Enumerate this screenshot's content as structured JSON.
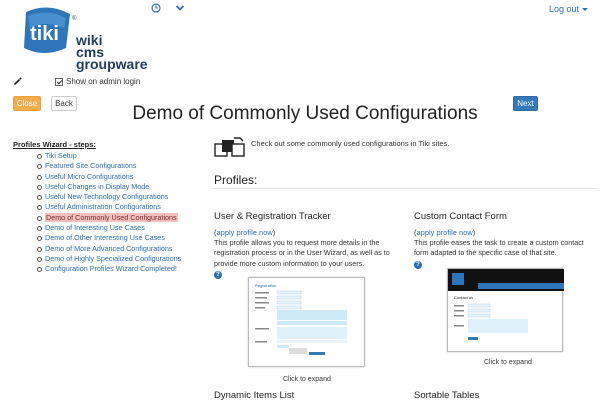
{
  "header": {
    "logout_label": "Log out",
    "icons": [
      "clock-icon",
      "chevron-down-icon"
    ]
  },
  "logo": {
    "brand": "tiki",
    "line1": "wiki",
    "line2": "cms",
    "line3": "groupware",
    "mark": "®"
  },
  "admin_login": {
    "label": "Show on admin login",
    "checked": true
  },
  "buttons": {
    "close": "Close",
    "back": "Back",
    "next": "Next"
  },
  "page_title": "Demo of Commonly Used Configurations",
  "sidebar": {
    "title": "Profiles Wizard - steps:",
    "steps": [
      "Tiki Setup",
      "Featured Site Configurations",
      "Useful Micro Configurations",
      "Useful Changes in Display Mode",
      "Useful New Technology Configurations",
      "Useful Administration Configurations",
      "Demo of Commonly Used Configurations",
      "Demo of Interesting Use Cases",
      "Demo of Other Interesting Use Cases",
      "Demo of More Advanced Configurations",
      "Demo of Highly Specialized Configurations",
      "Configuration Profiles Wizard Completed!"
    ],
    "active_index": 6
  },
  "intro_text": "Check out some commonly used configurations in Tiki sites.",
  "profiles_heading": "Profiles:",
  "cards": [
    {
      "title": "User & Registration Tracker",
      "link": "apply profile now",
      "description": "This profile allows you to request more details in the registration process or in the User Wizard, as well as to provide more custom information to your users.",
      "expand": "Click to expand",
      "thumb_title": "Registration"
    },
    {
      "title": "Custom Contact Form",
      "link": "apply profile now",
      "description": "This profile eases the task to create a custom contact form adapted to the specific case of that site.",
      "expand": "Click to expand",
      "thumb_title": "Contact us"
    }
  ],
  "more_sections": [
    "Dynamic Items List",
    "Sortable Tables"
  ],
  "colors": {
    "link": "#2f6fb2",
    "close_button": "#f0ad4e",
    "next_button": "#337ab7",
    "active_step_bg": "#f2c0bf"
  }
}
